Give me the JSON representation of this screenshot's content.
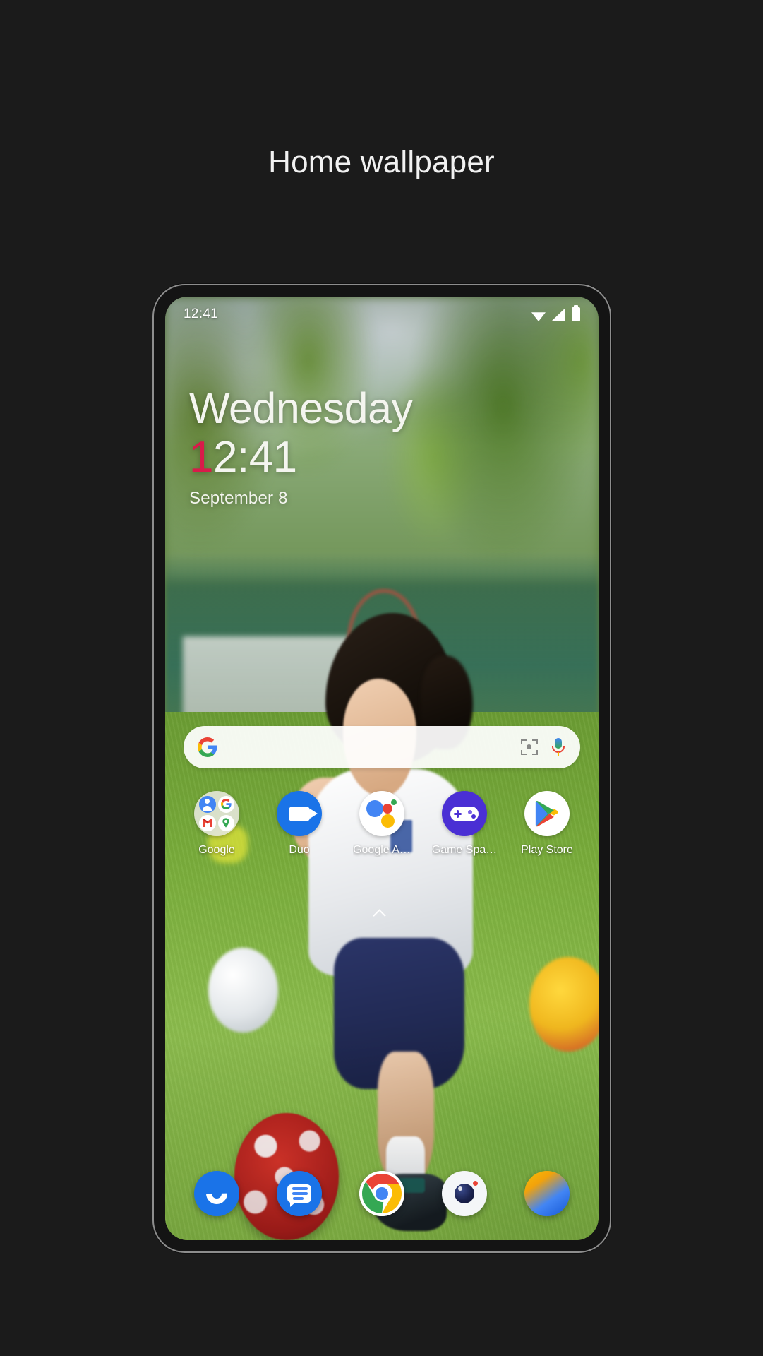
{
  "page": {
    "title": "Home wallpaper",
    "background_color": "#1b1b1b"
  },
  "phone": {
    "status_bar": {
      "time": "12:41",
      "icons": [
        "wifi-icon",
        "cellular-signal-icon",
        "battery-icon"
      ]
    },
    "clock_widget": {
      "day": "Wednesday",
      "time_accent_digit": "1",
      "time_rest": "2:41",
      "time_full": "12:41",
      "date": "September 8",
      "accent_color": "#d81b4a",
      "text_color": "#f4f5ef"
    },
    "search_bar": {
      "logo": "google-g-logo",
      "lens_icon": "google-lens-icon",
      "mic_icon": "microphone-icon",
      "placeholder": ""
    },
    "app_grid": [
      {
        "label": "Google",
        "icon": "google-folder-icon"
      },
      {
        "label": "Duo",
        "icon": "duo-icon"
      },
      {
        "label": "Google A…",
        "icon": "google-assistant-icon"
      },
      {
        "label": "Game Spa…",
        "icon": "game-space-icon"
      },
      {
        "label": "Play Store",
        "icon": "play-store-icon"
      }
    ],
    "page_indicator": "chevron-up-icon",
    "dock": [
      {
        "label": "Phone",
        "icon": "phone-icon"
      },
      {
        "label": "Messages",
        "icon": "messages-icon"
      },
      {
        "label": "Chrome",
        "icon": "chrome-icon"
      },
      {
        "label": "Camera",
        "icon": "camera-icon"
      },
      {
        "label": "Photos",
        "icon": "photos-icon"
      }
    ]
  }
}
